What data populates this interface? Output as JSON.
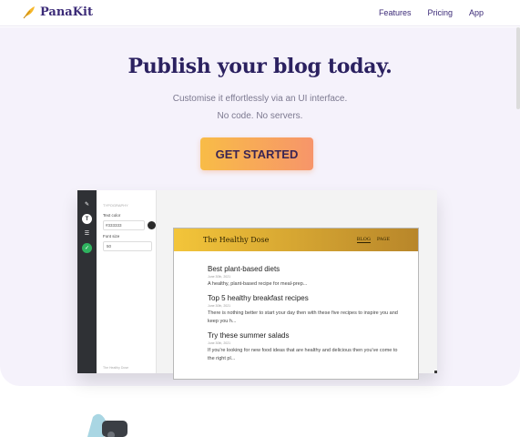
{
  "header": {
    "brand": "PanaKit",
    "nav": [
      {
        "label": "Features"
      },
      {
        "label": "Pricing"
      },
      {
        "label": "App"
      }
    ]
  },
  "hero": {
    "title": "Publish your blog today.",
    "subtitle_1": "Customise it effortlessly via an UI interface.",
    "subtitle_2": "No code. No servers.",
    "cta": "GET STARTED"
  },
  "editor": {
    "sidebar_icons": [
      "brush-icon",
      "text-format-icon",
      "list-icon",
      "check-icon"
    ],
    "panel": {
      "heading": "TYPOGRAPHY",
      "text_color_label": "Text color",
      "text_color_value": "#333333",
      "font_size_label": "Font size",
      "font_size_value": "50",
      "footer": "The Healthy Dose"
    },
    "preview": {
      "site_title": "The Healthy Dose",
      "nav": [
        "BLOG",
        "PAGE"
      ],
      "posts": [
        {
          "title": "Best plant-based diets",
          "date": "June 30th, 2021",
          "excerpt": "A healthy, plant-based recipe for meal-prep..."
        },
        {
          "title": "Top 5 healthy breakfast recipes",
          "date": "June 30th, 2021",
          "excerpt": "There is nothing better to start your day then with these five recipes to inspire you and keep you h..."
        },
        {
          "title": "Try these summer salads",
          "date": "June 30th, 2021",
          "excerpt": "If you're looking for new food ideas that are healthy and delicious then you've come to the right pl..."
        }
      ]
    }
  },
  "colors": {
    "accent_start": "#f8bc47",
    "accent_end": "#f7956a",
    "heading": "#2b2160",
    "hero_bg": "#f5f2fb",
    "check": "#2fb35f"
  }
}
